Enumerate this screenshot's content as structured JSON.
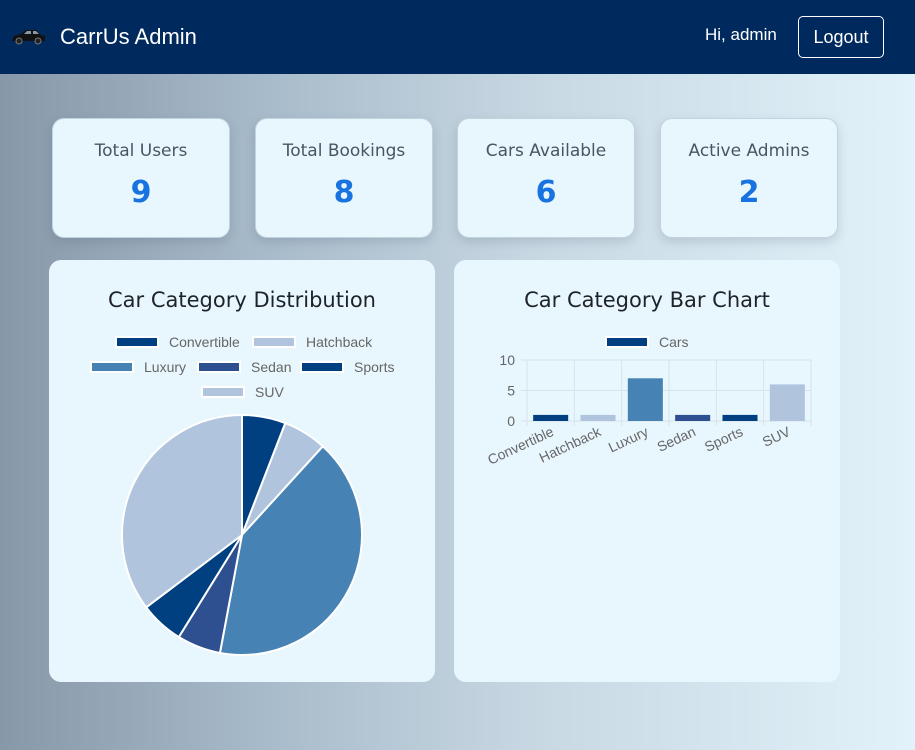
{
  "header": {
    "brand_title": "CarrUs Admin",
    "logo_icon": "car-icon",
    "greeting": "Hi, admin",
    "logout_label": "Logout"
  },
  "stats": [
    {
      "label": "Total Users",
      "value": "9"
    },
    {
      "label": "Total Bookings",
      "value": "8"
    },
    {
      "label": "Cars Available",
      "value": "6"
    },
    {
      "label": "Active Admins",
      "value": "2"
    }
  ],
  "colors": {
    "navbar": "#002a5e",
    "stat_value": "#1873e0",
    "convertible": "#004080",
    "hatchback": "#b0c4de",
    "luxury": "#4682b4",
    "sedan": "#2f5090",
    "sports": "#004080",
    "suv": "#b0c4de"
  },
  "chart_data": [
    {
      "type": "pie",
      "title": "Car Category Distribution",
      "categories": [
        "Convertible",
        "Hatchback",
        "Luxury",
        "Sedan",
        "Sports",
        "SUV"
      ],
      "values": [
        1,
        1,
        7,
        1,
        1,
        6
      ],
      "colors": [
        "#004080",
        "#b0c4de",
        "#4682b4",
        "#2f5090",
        "#004080",
        "#b0c4de"
      ],
      "legend": "top"
    },
    {
      "type": "bar",
      "title": "Car Category Bar Chart",
      "categories": [
        "Convertible",
        "Hatchback",
        "Luxury",
        "Sedan",
        "Sports",
        "SUV"
      ],
      "series": [
        {
          "name": "Cars",
          "values": [
            1,
            1,
            7,
            1,
            1,
            6
          ]
        }
      ],
      "colors": [
        "#004080",
        "#b0c4de",
        "#4682b4",
        "#2f5090",
        "#004080",
        "#b0c4de"
      ],
      "ylim": [
        0,
        10
      ],
      "yticks": [
        "10",
        "5",
        "0"
      ],
      "grid": true,
      "legend": "top"
    }
  ]
}
